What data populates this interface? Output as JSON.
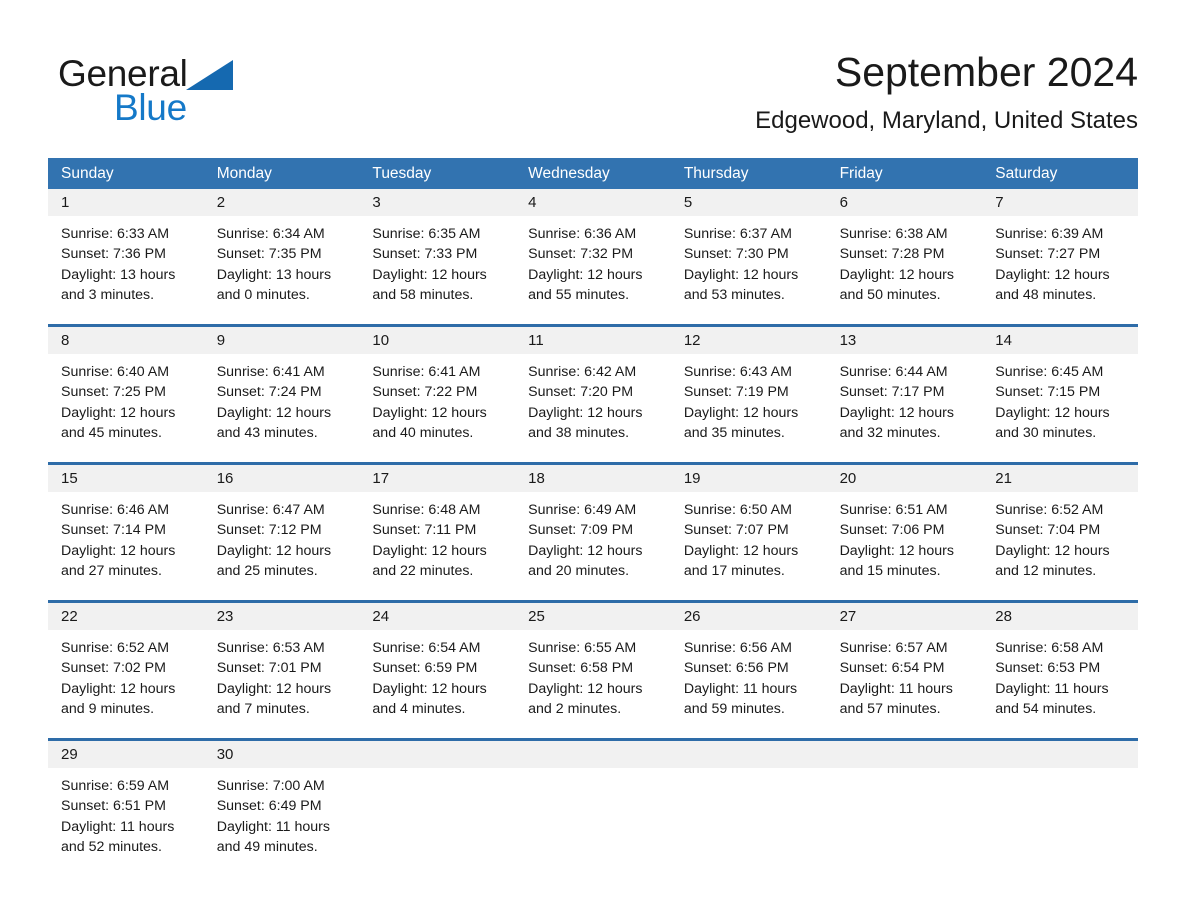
{
  "brand": {
    "name_part1": "General",
    "name_part2": "Blue",
    "triangle_color": "#1569b0",
    "blue_color": "#1579c8"
  },
  "header": {
    "title": "September 2024",
    "subtitle": "Edgewood, Maryland, United States"
  },
  "theme": {
    "header_blue": "#3273b0",
    "divider_blue": "#2e6ca8",
    "daynum_band": "#f1f1f1"
  },
  "calendar": {
    "weekday_headers": [
      "Sunday",
      "Monday",
      "Tuesday",
      "Wednesday",
      "Thursday",
      "Friday",
      "Saturday"
    ],
    "weeks": [
      {
        "days": [
          {
            "num": "1",
            "sunrise": "Sunrise: 6:33 AM",
            "sunset": "Sunset: 7:36 PM",
            "daylight": "Daylight: 13 hours and 3 minutes."
          },
          {
            "num": "2",
            "sunrise": "Sunrise: 6:34 AM",
            "sunset": "Sunset: 7:35 PM",
            "daylight": "Daylight: 13 hours and 0 minutes."
          },
          {
            "num": "3",
            "sunrise": "Sunrise: 6:35 AM",
            "sunset": "Sunset: 7:33 PM",
            "daylight": "Daylight: 12 hours and 58 minutes."
          },
          {
            "num": "4",
            "sunrise": "Sunrise: 6:36 AM",
            "sunset": "Sunset: 7:32 PM",
            "daylight": "Daylight: 12 hours and 55 minutes."
          },
          {
            "num": "5",
            "sunrise": "Sunrise: 6:37 AM",
            "sunset": "Sunset: 7:30 PM",
            "daylight": "Daylight: 12 hours and 53 minutes."
          },
          {
            "num": "6",
            "sunrise": "Sunrise: 6:38 AM",
            "sunset": "Sunset: 7:28 PM",
            "daylight": "Daylight: 12 hours and 50 minutes."
          },
          {
            "num": "7",
            "sunrise": "Sunrise: 6:39 AM",
            "sunset": "Sunset: 7:27 PM",
            "daylight": "Daylight: 12 hours and 48 minutes."
          }
        ]
      },
      {
        "days": [
          {
            "num": "8",
            "sunrise": "Sunrise: 6:40 AM",
            "sunset": "Sunset: 7:25 PM",
            "daylight": "Daylight: 12 hours and 45 minutes."
          },
          {
            "num": "9",
            "sunrise": "Sunrise: 6:41 AM",
            "sunset": "Sunset: 7:24 PM",
            "daylight": "Daylight: 12 hours and 43 minutes."
          },
          {
            "num": "10",
            "sunrise": "Sunrise: 6:41 AM",
            "sunset": "Sunset: 7:22 PM",
            "daylight": "Daylight: 12 hours and 40 minutes."
          },
          {
            "num": "11",
            "sunrise": "Sunrise: 6:42 AM",
            "sunset": "Sunset: 7:20 PM",
            "daylight": "Daylight: 12 hours and 38 minutes."
          },
          {
            "num": "12",
            "sunrise": "Sunrise: 6:43 AM",
            "sunset": "Sunset: 7:19 PM",
            "daylight": "Daylight: 12 hours and 35 minutes."
          },
          {
            "num": "13",
            "sunrise": "Sunrise: 6:44 AM",
            "sunset": "Sunset: 7:17 PM",
            "daylight": "Daylight: 12 hours and 32 minutes."
          },
          {
            "num": "14",
            "sunrise": "Sunrise: 6:45 AM",
            "sunset": "Sunset: 7:15 PM",
            "daylight": "Daylight: 12 hours and 30 minutes."
          }
        ]
      },
      {
        "days": [
          {
            "num": "15",
            "sunrise": "Sunrise: 6:46 AM",
            "sunset": "Sunset: 7:14 PM",
            "daylight": "Daylight: 12 hours and 27 minutes."
          },
          {
            "num": "16",
            "sunrise": "Sunrise: 6:47 AM",
            "sunset": "Sunset: 7:12 PM",
            "daylight": "Daylight: 12 hours and 25 minutes."
          },
          {
            "num": "17",
            "sunrise": "Sunrise: 6:48 AM",
            "sunset": "Sunset: 7:11 PM",
            "daylight": "Daylight: 12 hours and 22 minutes."
          },
          {
            "num": "18",
            "sunrise": "Sunrise: 6:49 AM",
            "sunset": "Sunset: 7:09 PM",
            "daylight": "Daylight: 12 hours and 20 minutes."
          },
          {
            "num": "19",
            "sunrise": "Sunrise: 6:50 AM",
            "sunset": "Sunset: 7:07 PM",
            "daylight": "Daylight: 12 hours and 17 minutes."
          },
          {
            "num": "20",
            "sunrise": "Sunrise: 6:51 AM",
            "sunset": "Sunset: 7:06 PM",
            "daylight": "Daylight: 12 hours and 15 minutes."
          },
          {
            "num": "21",
            "sunrise": "Sunrise: 6:52 AM",
            "sunset": "Sunset: 7:04 PM",
            "daylight": "Daylight: 12 hours and 12 minutes."
          }
        ]
      },
      {
        "days": [
          {
            "num": "22",
            "sunrise": "Sunrise: 6:52 AM",
            "sunset": "Sunset: 7:02 PM",
            "daylight": "Daylight: 12 hours and 9 minutes."
          },
          {
            "num": "23",
            "sunrise": "Sunrise: 6:53 AM",
            "sunset": "Sunset: 7:01 PM",
            "daylight": "Daylight: 12 hours and 7 minutes."
          },
          {
            "num": "24",
            "sunrise": "Sunrise: 6:54 AM",
            "sunset": "Sunset: 6:59 PM",
            "daylight": "Daylight: 12 hours and 4 minutes."
          },
          {
            "num": "25",
            "sunrise": "Sunrise: 6:55 AM",
            "sunset": "Sunset: 6:58 PM",
            "daylight": "Daylight: 12 hours and 2 minutes."
          },
          {
            "num": "26",
            "sunrise": "Sunrise: 6:56 AM",
            "sunset": "Sunset: 6:56 PM",
            "daylight": "Daylight: 11 hours and 59 minutes."
          },
          {
            "num": "27",
            "sunrise": "Sunrise: 6:57 AM",
            "sunset": "Sunset: 6:54 PM",
            "daylight": "Daylight: 11 hours and 57 minutes."
          },
          {
            "num": "28",
            "sunrise": "Sunrise: 6:58 AM",
            "sunset": "Sunset: 6:53 PM",
            "daylight": "Daylight: 11 hours and 54 minutes."
          }
        ]
      },
      {
        "days": [
          {
            "num": "29",
            "sunrise": "Sunrise: 6:59 AM",
            "sunset": "Sunset: 6:51 PM",
            "daylight": "Daylight: 11 hours and 52 minutes."
          },
          {
            "num": "30",
            "sunrise": "Sunrise: 7:00 AM",
            "sunset": "Sunset: 6:49 PM",
            "daylight": "Daylight: 11 hours and 49 minutes."
          },
          {
            "num": "",
            "sunrise": "",
            "sunset": "",
            "daylight": ""
          },
          {
            "num": "",
            "sunrise": "",
            "sunset": "",
            "daylight": ""
          },
          {
            "num": "",
            "sunrise": "",
            "sunset": "",
            "daylight": ""
          },
          {
            "num": "",
            "sunrise": "",
            "sunset": "",
            "daylight": ""
          },
          {
            "num": "",
            "sunrise": "",
            "sunset": "",
            "daylight": ""
          }
        ]
      }
    ]
  }
}
